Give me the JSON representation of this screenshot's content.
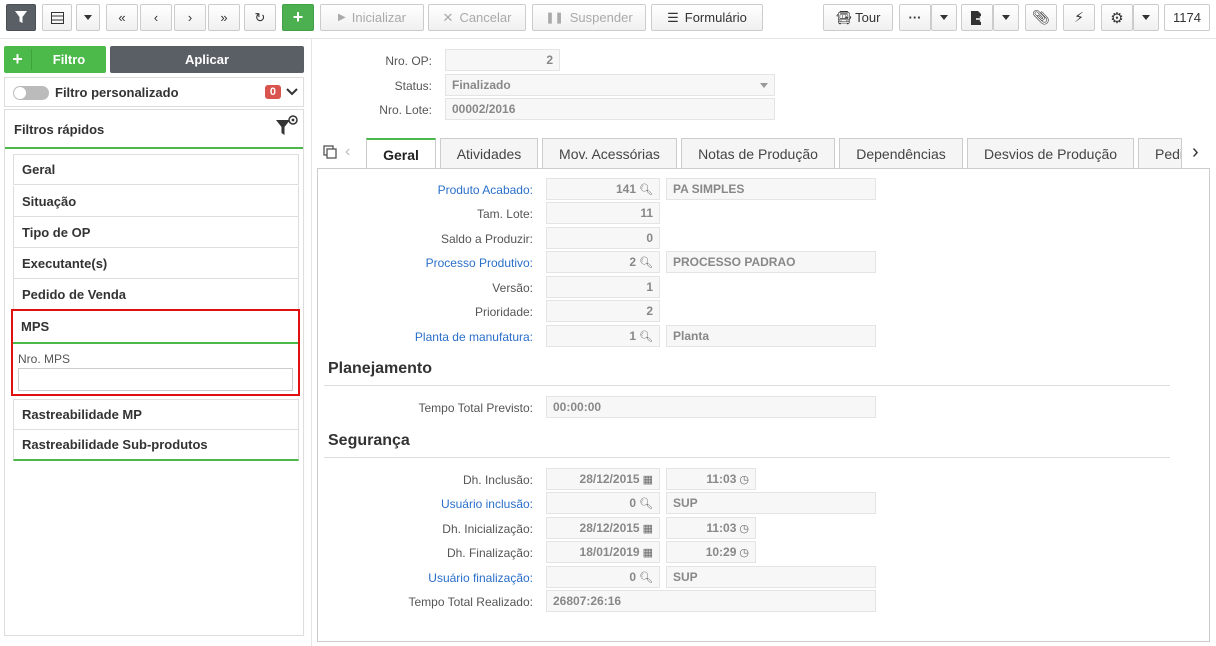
{
  "toolbar": {
    "start_label": "Inicializar",
    "cancel_label": "Cancelar",
    "suspend_label": "Suspender",
    "form_label": "Formulário",
    "tour_label": "Tour",
    "record_id": "1174"
  },
  "left": {
    "filter_label": "Filtro",
    "apply_label": "Aplicar",
    "custom_filter_label": "Filtro personalizado",
    "custom_filter_count": "0",
    "quick_filters_label": "Filtros rápidos",
    "items": [
      "Geral",
      "Situação",
      "Tipo de OP",
      "Executante(s)",
      "Pedido de Venda"
    ],
    "mps": {
      "label": "MPS",
      "field_label": "Nro. MPS",
      "field_value": ""
    },
    "items_after": [
      "Rastreabilidade MP",
      "Rastreabilidade Sub-produtos"
    ]
  },
  "header": {
    "nro_op_label": "Nro. OP:",
    "nro_op_value": "2",
    "status_label": "Status:",
    "status_value": "Finalizado",
    "lote_label": "Nro. Lote:",
    "lote_value": "00002/2016"
  },
  "tabs": [
    "Geral",
    "Atividades",
    "Mov. Acessórias",
    "Notas de Produção",
    "Dependências",
    "Desvios de Produção",
    "Pedi"
  ],
  "geral": {
    "produto_label": "Produto Acabado:",
    "produto_code": "141",
    "produto_name": "PA SIMPLES",
    "tam_lote_label": "Tam. Lote:",
    "tam_lote": "11",
    "saldo_label": "Saldo a Produzir:",
    "saldo": "0",
    "processo_label": "Processo Produtivo:",
    "processo_code": "2",
    "processo_name": "PROCESSO PADRAO",
    "versao_label": "Versão:",
    "versao": "1",
    "prioridade_label": "Prioridade:",
    "prioridade": "2",
    "planta_label": "Planta de manufatura:",
    "planta_code": "1",
    "planta_name": "Planta"
  },
  "planejamento": {
    "title": "Planejamento",
    "tempo_label": "Tempo Total Previsto:",
    "tempo": "00:00:00"
  },
  "seguranca": {
    "title": "Segurança",
    "inclusao_label": "Dh. Inclusão:",
    "inclusao_date": "28/12/2015",
    "inclusao_time": "11:03",
    "user_inc_label": "Usuário inclusão:",
    "user_inc_code": "0",
    "user_inc_name": "SUP",
    "inicial_label": "Dh. Inicialização:",
    "inicial_date": "28/12/2015",
    "inicial_time": "11:03",
    "final_label": "Dh. Finalização:",
    "final_date": "18/01/2019",
    "final_time": "10:29",
    "user_fin_label": "Usuário finalização:",
    "user_fin_code": "0",
    "user_fin_name": "SUP",
    "realizado_label": "Tempo Total Realizado:",
    "realizado": "26807:26:16"
  }
}
